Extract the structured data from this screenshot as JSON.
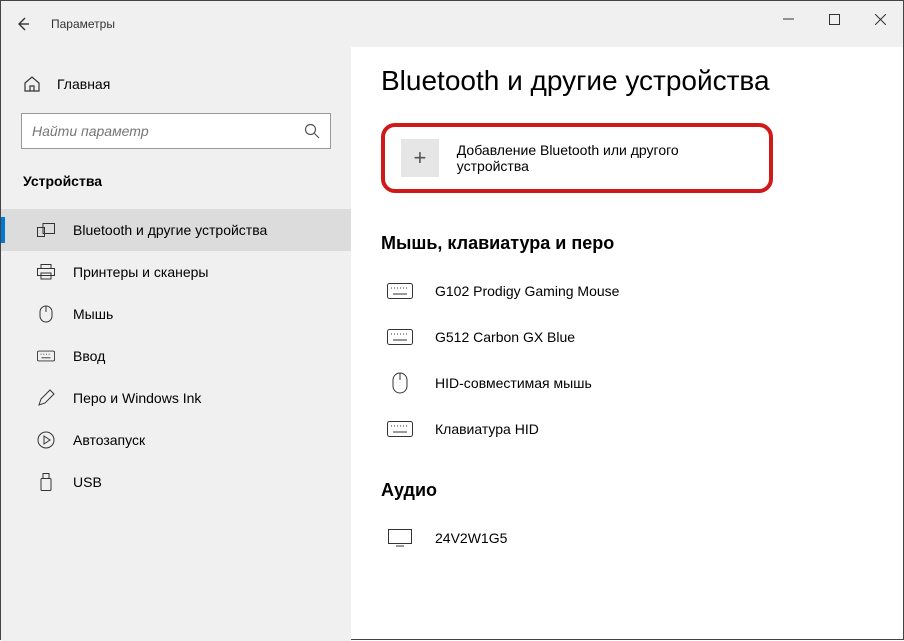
{
  "window": {
    "title": "Параметры"
  },
  "sidebar": {
    "home": "Главная",
    "search_placeholder": "Найти параметр",
    "section": "Устройства",
    "items": [
      {
        "label": "Bluetooth и другие устройства"
      },
      {
        "label": "Принтеры и сканеры"
      },
      {
        "label": "Мышь"
      },
      {
        "label": "Ввод"
      },
      {
        "label": "Перо и Windows Ink"
      },
      {
        "label": "Автозапуск"
      },
      {
        "label": "USB"
      }
    ]
  },
  "content": {
    "title": "Bluetooth и другие устройства",
    "add_device": "Добавление Bluetooth или другого устройства",
    "section_input": "Мышь, клавиатура и перо",
    "devices": [
      {
        "label": "G102 Prodigy Gaming Mouse",
        "type": "keyboard"
      },
      {
        "label": "G512 Carbon GX Blue",
        "type": "keyboard"
      },
      {
        "label": "HID-совместимая мышь",
        "type": "mouse"
      },
      {
        "label": "Клавиатура HID",
        "type": "keyboard"
      }
    ],
    "section_audio": "Аудио",
    "audio_devices": [
      {
        "label": "24V2W1G5",
        "type": "monitor"
      }
    ]
  }
}
